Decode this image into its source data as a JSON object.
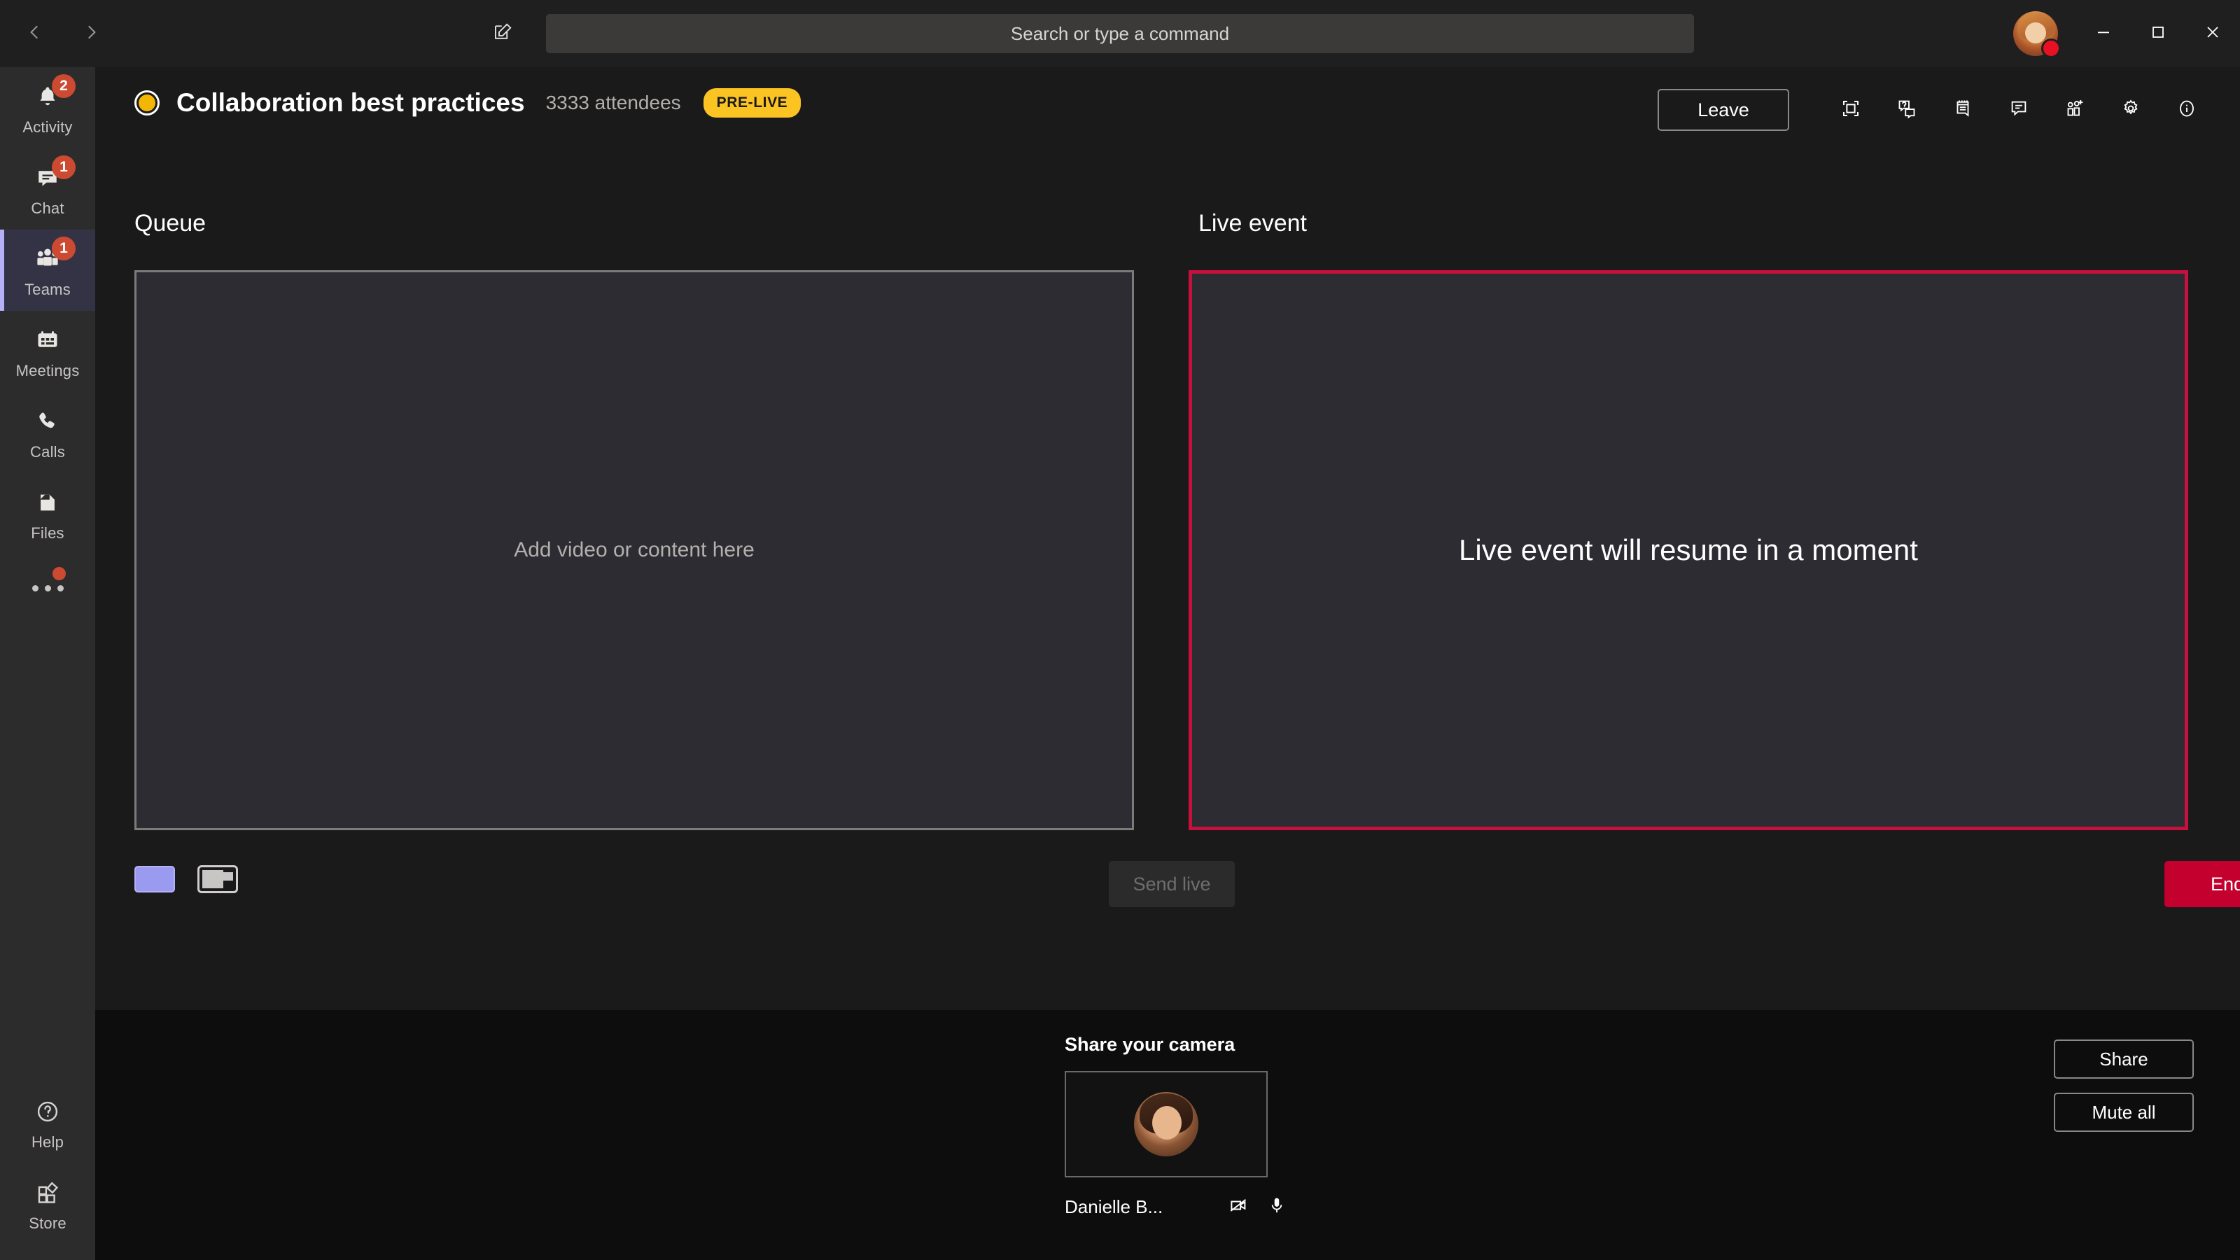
{
  "titlebar": {
    "back_icon": "chevron-left-icon",
    "forward_icon": "chevron-right-icon",
    "compose_icon": "compose-pencil-icon",
    "search": {
      "placeholder": "Search or type a command",
      "value": ""
    },
    "avatar_presence": "busy",
    "minimize_label": "Minimize",
    "maximize_label": "Maximize",
    "close_label": "Close"
  },
  "rail": {
    "items": [
      {
        "label": "Activity",
        "icon": "bell-icon",
        "badge": "2",
        "active": false
      },
      {
        "label": "Chat",
        "icon": "chat-bubble-icon",
        "badge": "1",
        "active": false
      },
      {
        "label": "Teams",
        "icon": "people-icon",
        "badge": "1",
        "active": true
      },
      {
        "label": "Meetings",
        "icon": "calendar-icon",
        "badge": "",
        "active": false
      },
      {
        "label": "Calls",
        "icon": "phone-icon",
        "badge": "",
        "active": false
      },
      {
        "label": "Files",
        "icon": "files-icon",
        "badge": "",
        "active": false
      }
    ],
    "more_label": "More",
    "bottom_items": [
      {
        "label": "Help",
        "icon": "help-circle-icon"
      },
      {
        "label": "Store",
        "icon": "store-icon"
      }
    ]
  },
  "event": {
    "status_indicator": "pre-live-dot",
    "title": "Collaboration best practices",
    "attendees": "3333 attendees",
    "state_badge": "PRE-LIVE",
    "leave_label": "Leave",
    "toolbar_icons": [
      "fullscreen-icon",
      "qna-icon",
      "notes-icon",
      "chat-icon",
      "add-people-icon",
      "settings-gear-icon",
      "info-icon"
    ]
  },
  "queue": {
    "label": "Queue",
    "placeholder": "Add video or content here",
    "layout_swatch_selected": "layout-solid-color",
    "layout_icon": "layout-content-with-pip",
    "send_live_label": "Send live",
    "send_live_enabled": false
  },
  "live": {
    "label": "Live event",
    "message": "Live event will resume in a moment",
    "end_label": "End",
    "border_color": "#c8103e"
  },
  "share_camera": {
    "heading": "Share your camera",
    "participant_name": "Danielle B...",
    "camera_icon": "camera-off-icon",
    "mic_icon": "microphone-icon",
    "share_label": "Share",
    "mute_all_label": "Mute all"
  },
  "colors": {
    "accent": "#b6b0f7",
    "live_red": "#c8103e",
    "end_red": "#c4002e",
    "badge_yellow": "#fcc423",
    "notification_orange": "#cc4a31",
    "presence_busy": "#e81123"
  }
}
